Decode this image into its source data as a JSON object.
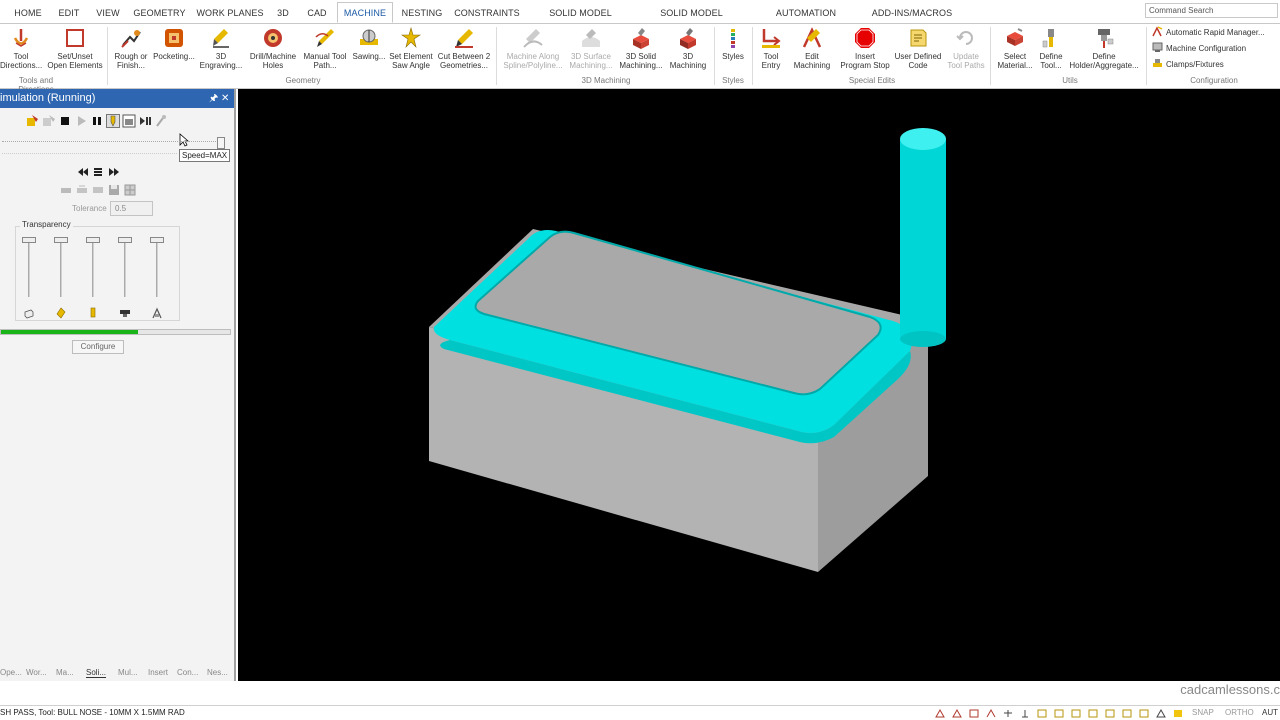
{
  "menu": {
    "tabs": [
      "HOME",
      "EDIT",
      "VIEW",
      "GEOMETRY",
      "WORK PLANES",
      "3D",
      "CAD",
      "MACHINE",
      "NESTING",
      "CONSTRAINTS",
      "SOLID MODEL EXTRACT",
      "SOLID MODEL UTILITIES",
      "AUTOMATION MANAGER",
      "ADD-INS/MACROS"
    ],
    "active": "MACHINE",
    "command_search": "Command Search"
  },
  "ribbon": {
    "buttons": [
      {
        "l1": "Tool",
        "l2": "Directions...",
        "icon": "tool-directions-icon"
      },
      {
        "l1": "Set/Unset",
        "l2": "Open Elements",
        "icon": "open-elements-icon"
      },
      {
        "l1": "Rough or",
        "l2": "Finish...",
        "icon": "rough-finish-icon"
      },
      {
        "l1": "Pocketing...",
        "l2": "",
        "icon": "pocketing-icon"
      },
      {
        "l1": "3D",
        "l2": "Engraving...",
        "icon": "engraving-icon"
      },
      {
        "l1": "Drill/Machine",
        "l2": "Holes",
        "icon": "drill-icon"
      },
      {
        "l1": "Manual Tool",
        "l2": "Path...",
        "icon": "manual-toolpath-icon"
      },
      {
        "l1": "Sawing...",
        "l2": "",
        "icon": "sawing-icon"
      },
      {
        "l1": "Set Element",
        "l2": "Saw Angle",
        "icon": "saw-angle-icon"
      },
      {
        "l1": "Cut Between 2",
        "l2": "Geometries...",
        "icon": "cut-between-icon"
      },
      {
        "l1": "Machine Along",
        "l2": "Spline/Polyline...",
        "icon": "machine-along-spline-icon",
        "disabled": true
      },
      {
        "l1": "3D Surface",
        "l2": "Machining...",
        "icon": "surface-machining-icon",
        "disabled": true
      },
      {
        "l1": "3D Solid",
        "l2": "Machining...",
        "icon": "solid-machining-icon"
      },
      {
        "l1": "3D",
        "l2": "Machining",
        "icon": "3d-machining-icon"
      },
      {
        "l1": "Styles",
        "l2": "",
        "icon": "styles-icon"
      },
      {
        "l1": "Tool",
        "l2": "Entry",
        "icon": "tool-entry-icon"
      },
      {
        "l1": "Edit",
        "l2": "Machining",
        "icon": "edit-machining-icon"
      },
      {
        "l1": "Insert",
        "l2": "Program Stop",
        "icon": "program-stop-icon"
      },
      {
        "l1": "User Defined",
        "l2": "Code",
        "icon": "user-code-icon"
      },
      {
        "l1": "Update",
        "l2": "Tool Paths",
        "icon": "update-toolpaths-icon",
        "disabled": true
      },
      {
        "l1": "Select",
        "l2": "Material...",
        "icon": "select-material-icon"
      },
      {
        "l1": "Define",
        "l2": "Tool...",
        "icon": "define-tool-icon"
      },
      {
        "l1": "Define",
        "l2": "Holder/Aggregate...",
        "icon": "define-holder-icon"
      }
    ],
    "groups": [
      "Tools and Directions",
      "Geometry",
      "3D Machining",
      "Styles",
      "Special Edits",
      "Utils",
      "Configuration"
    ],
    "config_items": [
      "Automatic Rapid Manager...",
      "Machine Configuration",
      "Clamps/Fixtures"
    ]
  },
  "panel": {
    "title": "imulation (Running)",
    "tooltip": "Speed=MAX",
    "tolerance_label": "Tolerance",
    "tolerance_value": "0.5",
    "transparency_label": "Transparency",
    "progress": 0.6,
    "configure_label": "Configure",
    "bottom_tabs": [
      "Ope...",
      "Wor...",
      "Ma...",
      "Soli...",
      "Mul...",
      "Insert",
      "Con...",
      "Nes..."
    ],
    "active_bottom_tab": "Soli..."
  },
  "viewport": {
    "tool_color": "#00e5e5",
    "stock_color": "#b4b4b4"
  },
  "watermark": "cadcamlessons.c",
  "status": {
    "text": "SH PASS, Tool: BULL NOSE - 10MM X 1.5MM RAD",
    "snap": "SNAP",
    "ortho": "ORTHO",
    "auto": "AUT"
  }
}
